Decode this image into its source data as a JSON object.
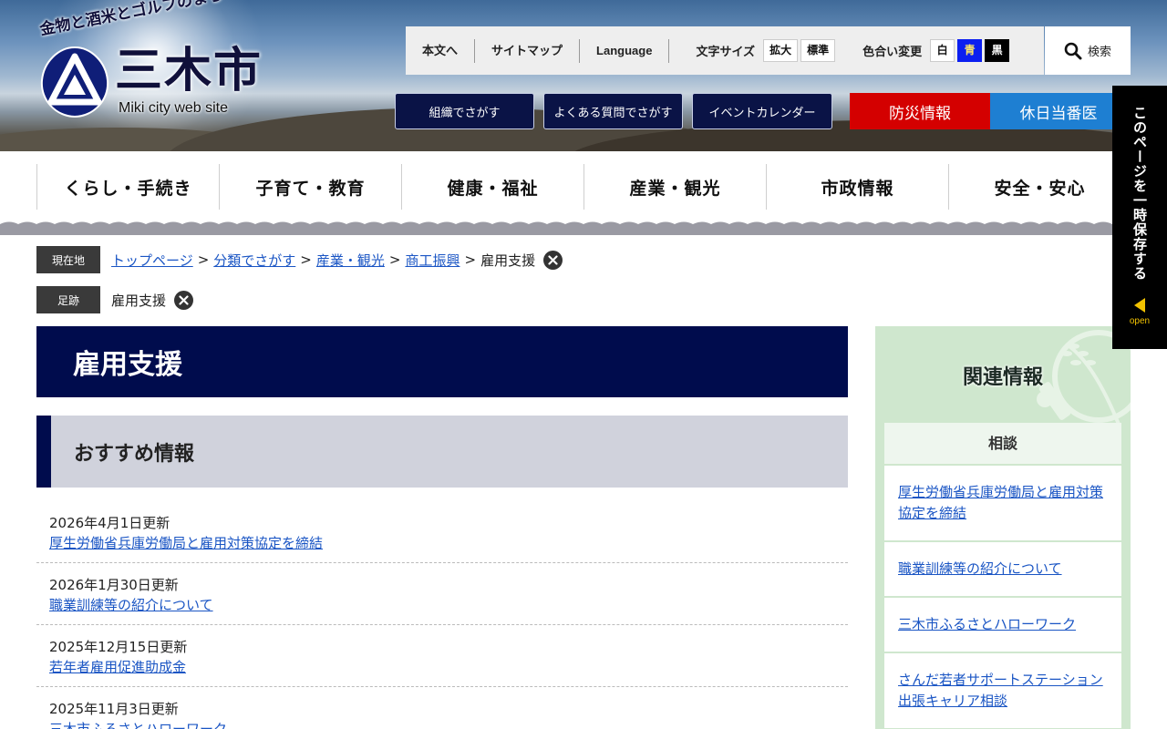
{
  "header": {
    "tagline": "金物と酒米とゴルフのまち",
    "city_name": "三木市",
    "site_subtitle": "Miki city web site",
    "util_links": [
      "本文へ",
      "サイトマップ",
      "Language"
    ],
    "font_size_label": "文字サイズ",
    "font_size_buttons": [
      "拡大",
      "標準"
    ],
    "color_label": "色合い変更",
    "color_buttons": [
      "白",
      "青",
      "黒"
    ],
    "search_label": "検索",
    "nav_buttons": [
      "組織でさがす",
      "よくある質問でさがす",
      "イベントカレンダー"
    ],
    "bosai": "防災情報",
    "kyujitsu": "休日当番医"
  },
  "global_nav": [
    "くらし・手続き",
    "子育て・教育",
    "健康・福祉",
    "産業・観光",
    "市政情報",
    "安全・安心"
  ],
  "breadcrumb": {
    "label": "現在地",
    "links": [
      "トップページ",
      "分類でさがす",
      "産業・観光",
      "商工振興"
    ],
    "current": "雇用支援"
  },
  "history": {
    "label": "足跡",
    "items": [
      "雇用支援"
    ]
  },
  "main": {
    "title": "雇用支援",
    "section_title": "おすすめ情報",
    "news": [
      {
        "date": "2026年4月1日更新",
        "title": "厚生労働省兵庫労働局と雇用対策協定を締結"
      },
      {
        "date": "2026年1月30日更新",
        "title": "職業訓練等の紹介について"
      },
      {
        "date": "2025年12月15日更新",
        "title": "若年者雇用促進助成金"
      },
      {
        "date": "2025年11月3日更新",
        "title": "三木市ふるさとハローワーク"
      }
    ]
  },
  "sidebar": {
    "title": "関連情報",
    "box_title": "相談",
    "items": [
      "厚生労働省兵庫労働局と雇用対策協定を締結",
      "職業訓練等の紹介について",
      "三木市ふるさとハローワーク",
      "さんだ若者サポートステーション出張キャリア相談"
    ]
  },
  "float_tab": {
    "text": "このページを一時保存する",
    "open_label": "open"
  },
  "colors": {
    "navy": "#000c4d",
    "bosai_red": "#d40000",
    "kyujitsu_blue": "#1e7fd2",
    "sidebar_green": "#cfe7ce",
    "link_blue": "#1a55c4"
  }
}
